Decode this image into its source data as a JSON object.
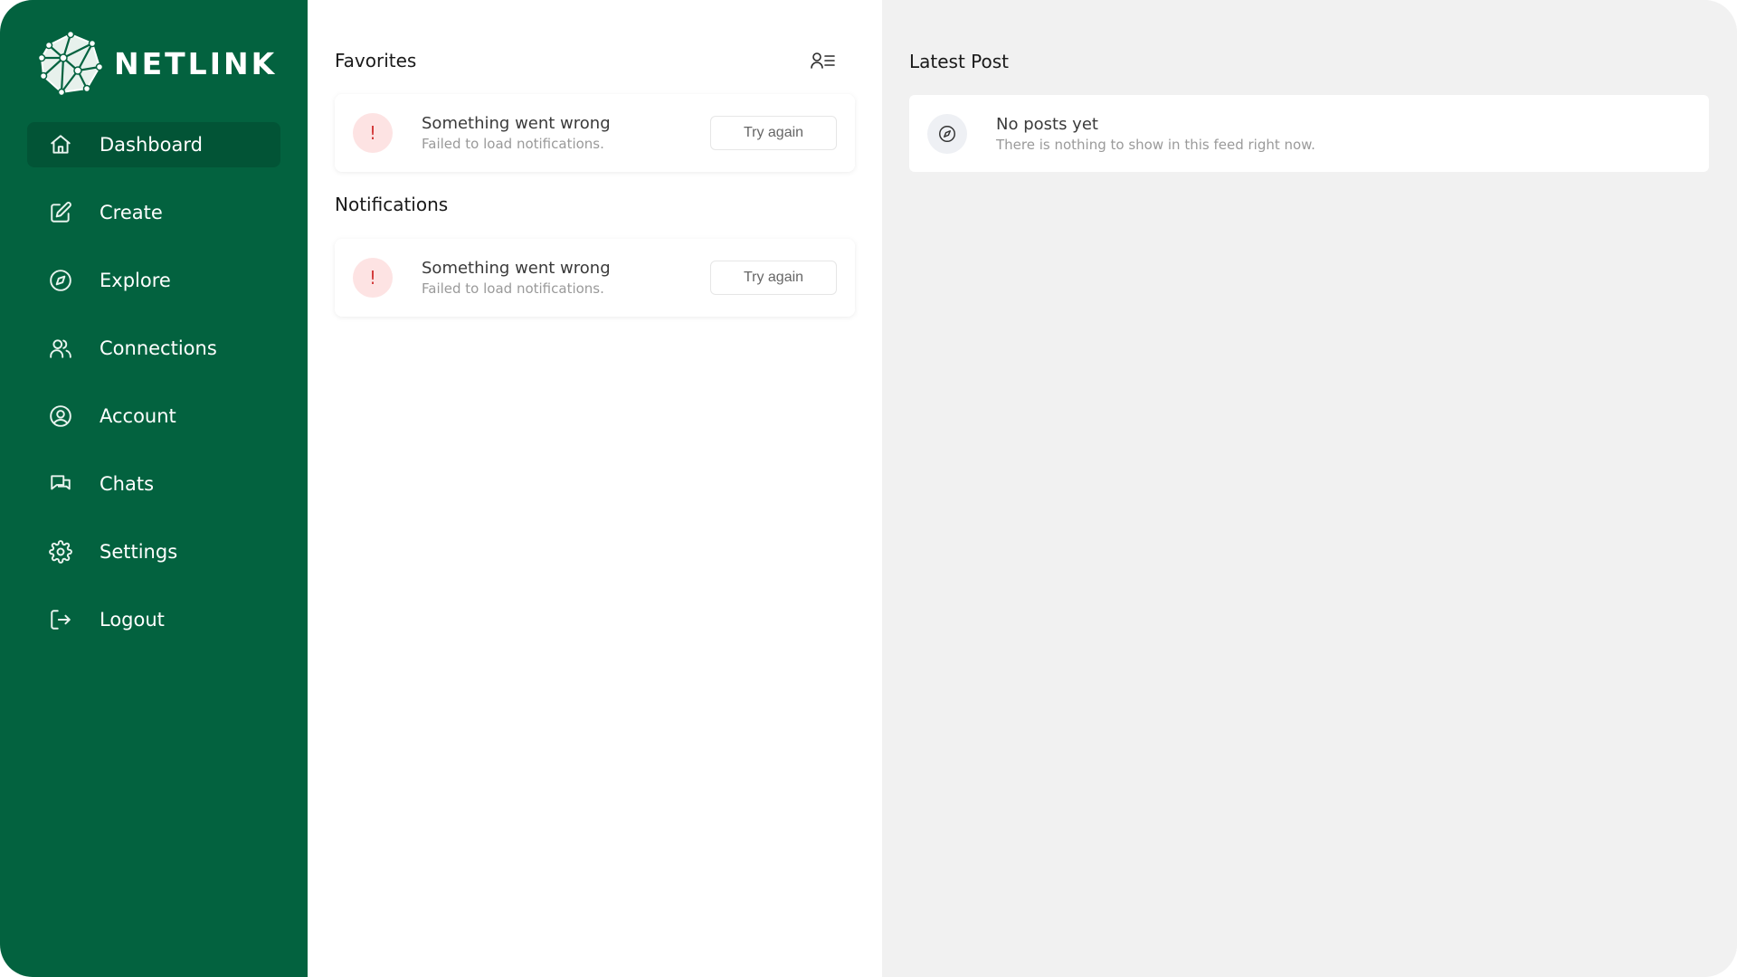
{
  "brand": {
    "name": "NETLINK",
    "primary_color": "#03623f",
    "active_color": "#025436"
  },
  "sidebar": {
    "items": [
      {
        "label": "Dashboard",
        "icon": "home-icon",
        "active": true
      },
      {
        "label": "Create",
        "icon": "edit-icon",
        "active": false
      },
      {
        "label": "Explore",
        "icon": "compass-icon",
        "active": false
      },
      {
        "label": "Connections",
        "icon": "users-icon",
        "active": false
      },
      {
        "label": "Account",
        "icon": "user-circle-icon",
        "active": false
      },
      {
        "label": "Chats",
        "icon": "chat-icon",
        "active": false
      },
      {
        "label": "Settings",
        "icon": "gear-icon",
        "active": false
      },
      {
        "label": "Logout",
        "icon": "logout-icon",
        "active": false
      }
    ]
  },
  "favorites": {
    "title": "Favorites",
    "error": {
      "icon": "!",
      "title": "Something went wrong",
      "subtitle": "Failed to load notifications.",
      "button": "Try again"
    }
  },
  "notifications": {
    "title": "Notifications",
    "error": {
      "icon": "!",
      "title": "Something went wrong",
      "subtitle": "Failed to load notifications.",
      "button": "Try again"
    }
  },
  "latest_post": {
    "title": "Latest Post",
    "empty": {
      "icon": "compass-icon",
      "title": "No posts yet",
      "subtitle": "There is nothing to show in this feed right now."
    }
  }
}
